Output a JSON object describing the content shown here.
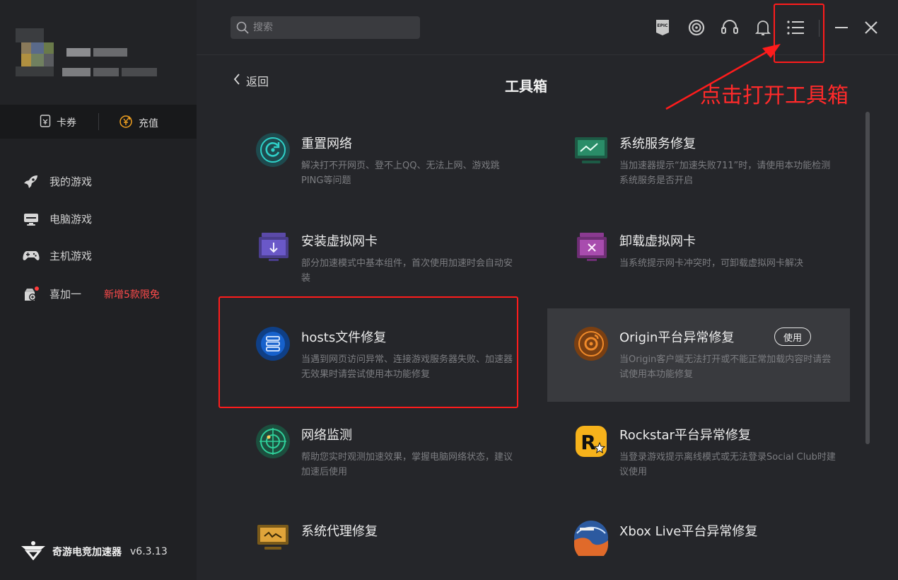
{
  "sidebar": {
    "wallet": {
      "coupon_label": "卡券",
      "recharge_label": "充值"
    },
    "nav": [
      {
        "label": "我的游戏",
        "icon": "rocket-icon"
      },
      {
        "label": "电脑游戏",
        "icon": "monitor-icon"
      },
      {
        "label": "主机游戏",
        "icon": "gamepad-icon"
      },
      {
        "label": "喜加一",
        "icon": "gift-icon",
        "badge": "新增5款限免"
      }
    ],
    "brand": {
      "name": "奇游电竞加速器",
      "version": "v6.3.13"
    }
  },
  "topbar": {
    "search_placeholder": "搜索",
    "icons": [
      "epic-games-icon",
      "ubisoft-icon",
      "headset-icon",
      "bell-icon",
      "list-menu-icon",
      "minimize-icon",
      "close-icon"
    ]
  },
  "page": {
    "back_label": "返回",
    "title": "工具箱",
    "annotation": "点击打开工具箱"
  },
  "tools": [
    {
      "name": "重置网络",
      "desc": "解决打不开网页、登不上QQ、无法上网、游戏跳PING等问题",
      "icon": "reset-network-icon"
    },
    {
      "name": "系统服务修复",
      "desc": "当加速器提示“加速失败711”时，请使用本功能检测系统服务是否开启",
      "icon": "system-service-icon"
    },
    {
      "name": "安装虚拟网卡",
      "desc": "部分加速模式中基本组件，首次使用加速时会自动安装",
      "icon": "install-adapter-icon"
    },
    {
      "name": "卸载虚拟网卡",
      "desc": "当系统提示网卡冲突时，可卸载虚拟网卡解决",
      "icon": "uninstall-adapter-icon"
    },
    {
      "name": "hosts文件修复",
      "desc": "当遇到网页访问异常、连接游戏服务器失败、加速器无效果时请尝试使用本功能修复",
      "icon": "hosts-repair-icon"
    },
    {
      "name": "Origin平台异常修复",
      "desc": "当Origin客户端无法打开或不能正常加载内容时请尝试使用本功能修复",
      "icon": "origin-icon",
      "action": "使用"
    },
    {
      "name": "网络监测",
      "desc": "帮助您实时观测加速效果，掌握电脑网络状态，建议加速后使用",
      "icon": "network-monitor-icon"
    },
    {
      "name": "Rockstar平台异常修复",
      "desc": "当登录游戏提示离线模式或无法登录Social Club时建议使用",
      "icon": "rockstar-icon"
    },
    {
      "name": "系统代理修复",
      "desc": "",
      "icon": "proxy-repair-icon"
    },
    {
      "name": "Xbox Live平台异常修复",
      "desc": "",
      "icon": "xbox-live-icon"
    }
  ],
  "colors": {
    "annotation_red": "#ff1c1c",
    "badge_red": "#ff4b4b",
    "highlight_bg": "#393a3e"
  }
}
